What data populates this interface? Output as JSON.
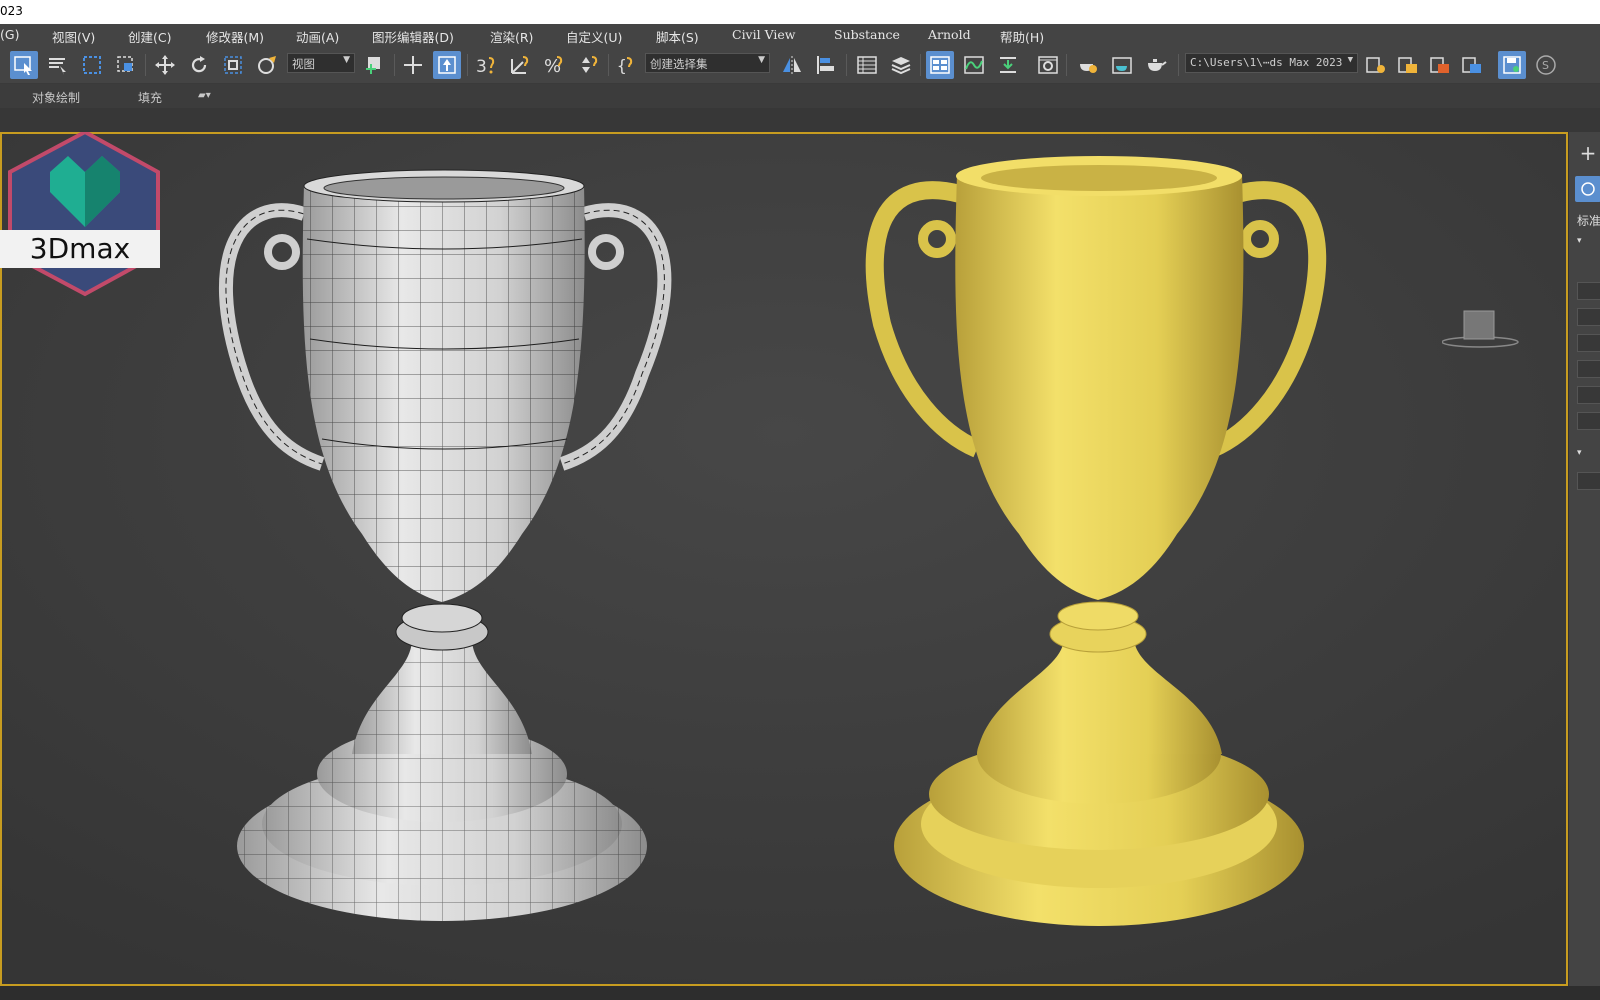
{
  "titlebar": {
    "text": "023"
  },
  "menu": {
    "items": [
      {
        "label": "(G)"
      },
      {
        "label": "视图(V)"
      },
      {
        "label": "创建(C)"
      },
      {
        "label": "修改器(M)"
      },
      {
        "label": "动画(A)"
      },
      {
        "label": "图形编辑器(D)"
      },
      {
        "label": "渲染(R)"
      },
      {
        "label": "自定义(U)"
      },
      {
        "label": "脚本(S)"
      },
      {
        "label": "Civil View"
      },
      {
        "label": "Substance"
      },
      {
        "label": "Arnold"
      },
      {
        "label": "帮助(H)"
      }
    ]
  },
  "toolbar": {
    "view_dropdown": "视图",
    "selection_set_dropdown": "创建选择集",
    "path_dropdown": "C:\\Users\\1\\⋯ds Max 2023"
  },
  "ribbon": {
    "tab_object_paint": "对象绘制",
    "tab_fill": "填充"
  },
  "logo": {
    "label": "3Dmax"
  },
  "command_panel": {
    "standard_label": "标准",
    "plus": "+"
  },
  "colors": {
    "accent_blue": "#5b8fcf",
    "viewport_border": "#c79c20",
    "trophy_gold": "#e8d45a",
    "logo_teal": "#1fae92",
    "logo_hex_pink": "#c24a6a"
  }
}
